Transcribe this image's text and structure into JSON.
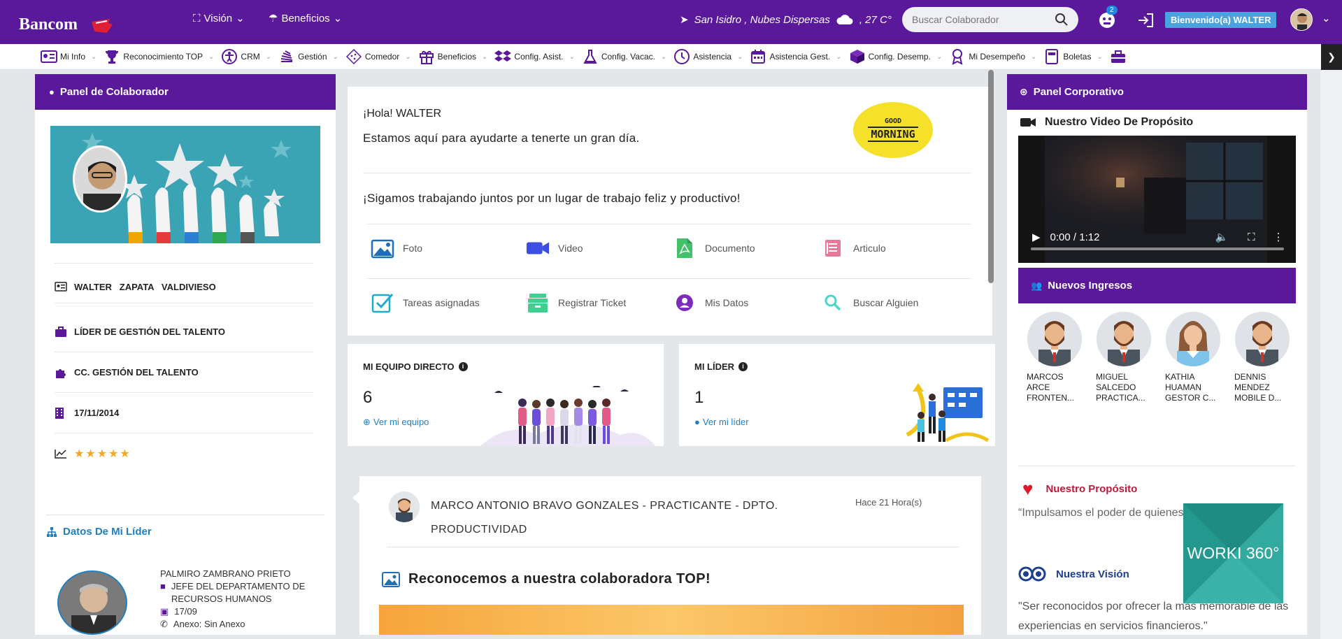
{
  "header": {
    "logo_text": "Bancom",
    "nav": [
      {
        "label": "Visión"
      },
      {
        "label": "Beneficios"
      }
    ],
    "weather": {
      "location": "San Isidro , Nubes Dispersas",
      "temp": ", 27 C°"
    },
    "search_placeholder": "Buscar Colaborador",
    "notifications_count": "2",
    "welcome_text": "Bienvenido(a) WALTER"
  },
  "menu": [
    {
      "label": "Mi Info",
      "icon": "id-card-icon"
    },
    {
      "label": "Reconocimiento TOP",
      "icon": "trophy-icon"
    },
    {
      "label": "CRM",
      "icon": "accessibility-icon"
    },
    {
      "label": "Gestión",
      "icon": "stack-icon"
    },
    {
      "label": "Comedor",
      "icon": "cookie-icon"
    },
    {
      "label": "Beneficios",
      "icon": "gift-icon"
    },
    {
      "label": "Config. Asist.",
      "icon": "dropbox-icon"
    },
    {
      "label": "Config. Vacac.",
      "icon": "flask-icon"
    },
    {
      "label": "Asistencia",
      "icon": "clock-icon"
    },
    {
      "label": "Asistencia Gest.",
      "icon": "calendar-icon"
    },
    {
      "label": "Config. Desemp.",
      "icon": "cube-icon"
    },
    {
      "label": "Mi Desempeño",
      "icon": "medal-icon"
    },
    {
      "label": "Boletas",
      "icon": "receipt-icon"
    },
    {
      "label": "",
      "icon": "toolbox-icon"
    }
  ],
  "left_panel": {
    "title": "Panel de Colaborador",
    "name": "WALTER   ZAPATA   VALDIVIESO",
    "role": "LÍDER DE GESTIÓN DEL TALENTO",
    "cost_center": "CC. GESTIÓN DEL TALENTO",
    "start_date": "17/11/2014",
    "rating": "★★★★★",
    "leader_section": {
      "title": "Datos De Mi Líder",
      "name": "PALMIRO ZAMBRANO PRIETO",
      "position": "JEFE DEL DEPARTAMENTO DE RECURSOS HUMANOS",
      "date": "17/09",
      "extension": "Anexo: Sin Anexo"
    }
  },
  "greeting": {
    "hello": "¡Hola! WALTER",
    "subtitle": "Estamos aquí para ayudarte a tenerte un gran día.",
    "motto": "¡Sigamos trabajando juntos por un lugar de trabajo feliz y productivo!",
    "badge_line1": "GOOD",
    "badge_line2": "MORNING",
    "actions": [
      "Foto",
      "Video",
      "Documento",
      "Articulo",
      "Tareas asignadas",
      "Registrar Ticket",
      "Mis Datos",
      "Buscar Alguien"
    ]
  },
  "team": {
    "title": "MI EQUIPO DIRECTO",
    "count": "6",
    "link": "Ver mi equipo"
  },
  "leader": {
    "title": "MI LÍDER",
    "count": "1",
    "link": "Ver mi líder"
  },
  "post": {
    "author_line1": "MARCO ANTONIO BRAVO GONZALES - PRACTICANTE - DPTO.",
    "author_line2": "PRODUCTIVIDAD",
    "time": "Hace 21 Hora(s)",
    "title": "Reconocemos a nuestra colaboradora TOP!"
  },
  "right_panel": {
    "title": "Panel Corporativo",
    "video_title": "Nuestro Video De Propósito",
    "video_time": "0:00 / 1:12",
    "new_hires_title": "Nuevos Ingresos",
    "new_hires": [
      {
        "l1": "MARCOS",
        "l2": "ARCE",
        "l3": "FRONTEN..."
      },
      {
        "l1": "MIGUEL",
        "l2": "SALCEDO",
        "l3": "PRACTICA..."
      },
      {
        "l1": "KATHIA",
        "l2": "HUAMAN",
        "l3": "GESTOR C..."
      },
      {
        "l1": "DENNIS",
        "l2": "MENDEZ",
        "l3": "MOBILE D..."
      }
    ],
    "purpose_title": "Nuestro Propósito",
    "purpose_text": "“Impulsamos el poder de quienes hacen sus sueños”.",
    "vision_title": "Nuestra Visión",
    "vision_text": "\"Ser reconocidos por ofrecer la más memorable de las experiencias en servicios financieros.\""
  },
  "watermark": "WORKI 360°",
  "colors": {
    "primary": "#5a189a",
    "accent_blue": "#1e7fc2",
    "purpose_red": "#c0183b",
    "vision_blue": "#1d3f8f",
    "watermark": "#2aa198"
  }
}
